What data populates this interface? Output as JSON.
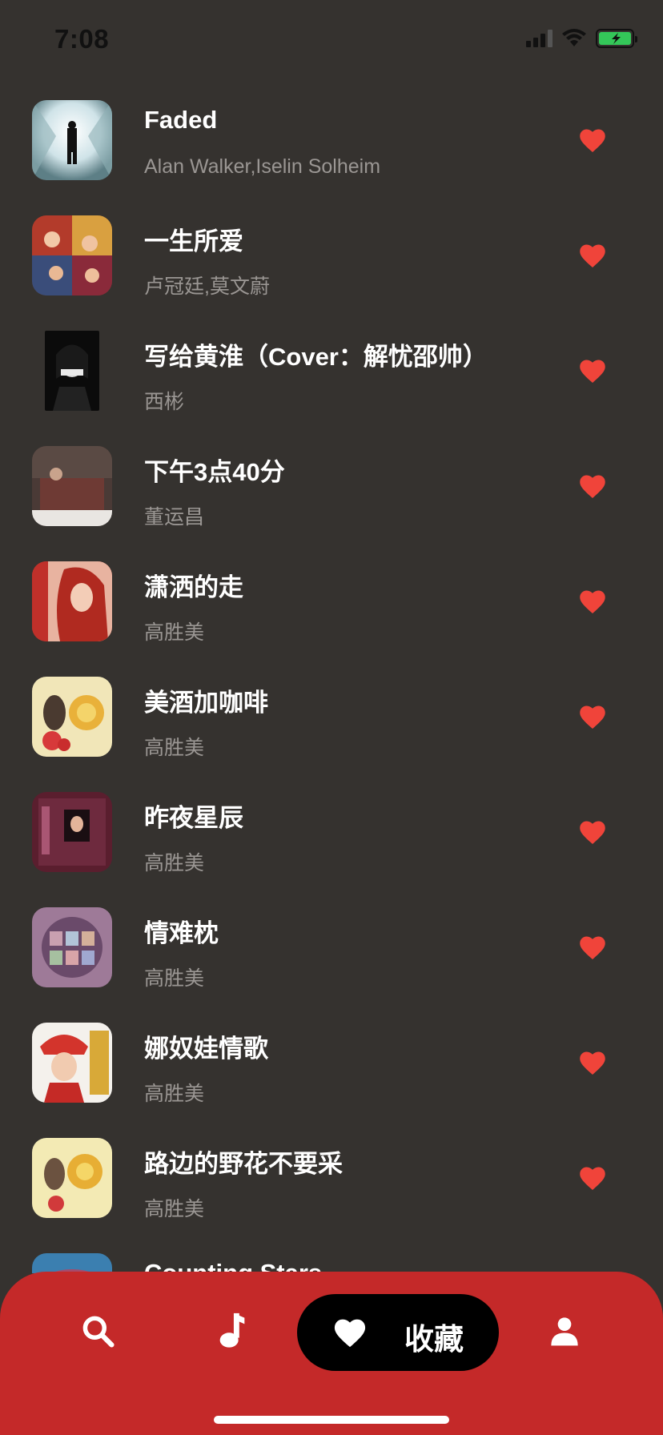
{
  "status_bar": {
    "time": "7:08"
  },
  "songs": [
    {
      "title": "Faded",
      "artist": "Alan Walker,Iselin Solheim",
      "favorited": true
    },
    {
      "title": "一生所爱",
      "artist": "卢冠廷,莫文蔚",
      "favorited": true
    },
    {
      "title": "写给黄淮（Cover：解忧邵帅）",
      "artist": "西彬",
      "favorited": true
    },
    {
      "title": "下午3点40分",
      "artist": "董运昌",
      "favorited": true
    },
    {
      "title": "潇洒的走",
      "artist": "高胜美",
      "favorited": true
    },
    {
      "title": "美酒加咖啡",
      "artist": "高胜美",
      "favorited": true
    },
    {
      "title": "昨夜星辰",
      "artist": "高胜美",
      "favorited": true
    },
    {
      "title": "情难枕",
      "artist": "高胜美",
      "favorited": true
    },
    {
      "title": "娜奴娃情歌",
      "artist": "高胜美",
      "favorited": true
    },
    {
      "title": "路边的野花不要采",
      "artist": "高胜美",
      "favorited": true
    },
    {
      "title": "Counting Stars",
      "artist": "",
      "favorited": true
    }
  ],
  "tab_bar": {
    "active_label": "收藏",
    "tabs": [
      "search-icon",
      "music-note-icon",
      "heart-icon",
      "person-icon"
    ]
  },
  "colors": {
    "background": "#35322f",
    "accent": "#c42929",
    "heart": "#f0443a",
    "muted_text": "#9a9693"
  }
}
